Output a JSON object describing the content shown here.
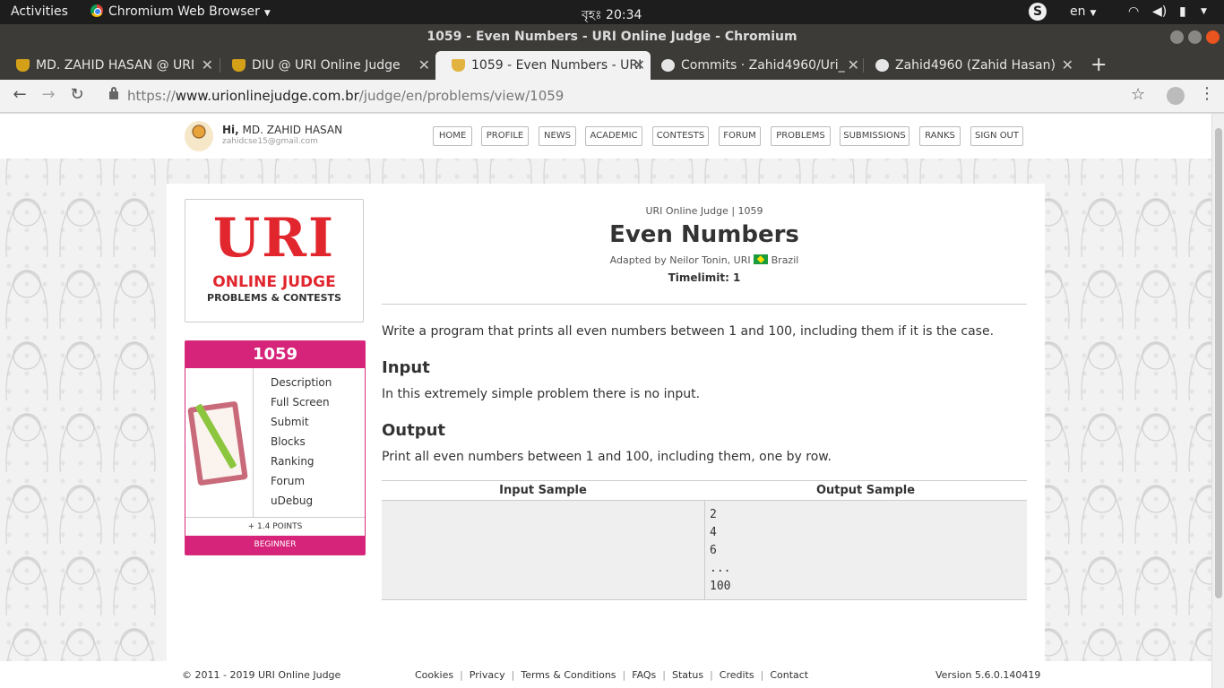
{
  "desktop": {
    "activities": "Activities",
    "app_menu": "Chromium Web Browser",
    "clock": "বৃহঃ 20:34",
    "language": "en"
  },
  "window": {
    "title": "1059 - Even Numbers - URI Online Judge - Chromium"
  },
  "tabs": [
    {
      "label": "MD. ZAHID HASAN @ URI",
      "icon": "trophy-icon"
    },
    {
      "label": "DIU @ URI Online Judge",
      "icon": "trophy-icon"
    },
    {
      "label": "1059 - Even Numbers - URI",
      "icon": "trophy-icon",
      "active": true
    },
    {
      "label": "Commits · Zahid4960/Uri_",
      "icon": "github-icon"
    },
    {
      "label": "Zahid4960 (Zahid Hasan)",
      "icon": "github-icon"
    }
  ],
  "address_bar": {
    "scheme": "https://",
    "host": "www.urionlinejudge.com.br",
    "path": "/judge/en/problems/view/1059"
  },
  "site": {
    "user": {
      "greeting": "Hi,",
      "name": "MD. ZAHID HASAN",
      "email": "zahidcse15@gmail.com"
    },
    "nav": [
      "HOME",
      "PROFILE",
      "NEWS",
      "ACADEMIC",
      "CONTESTS",
      "FORUM",
      "PROBLEMS",
      "SUBMISSIONS",
      "RANKS",
      "SIGN OUT"
    ]
  },
  "logo": {
    "main": "URI",
    "line1": "ONLINE JUDGE",
    "line2": "PROBLEMS & CONTESTS"
  },
  "problem_card": {
    "number": "1059",
    "links": [
      "Description",
      "Full Screen",
      "Submit",
      "Blocks",
      "Ranking",
      "Forum",
      "uDebug"
    ],
    "points": "+ 1.4 POINTS",
    "level": "BEGINNER"
  },
  "problem": {
    "breadcrumb": "URI Online Judge | 1059",
    "title": "Even Numbers",
    "adapted_prefix": "Adapted by Neilor Tonin, URI",
    "adapted_country": "Brazil",
    "timelimit": "Timelimit: 1",
    "description": "Write a program that prints all even numbers between 1 and 100, including them if it is the case.",
    "input_heading": "Input",
    "input_text": "In this extremely simple problem there is no input.",
    "output_heading": "Output",
    "output_text": "Print all even numbers between 1 and 100, including them, one by row.",
    "sample_input_header": "Input Sample",
    "sample_output_header": "Output Sample",
    "sample_input": "",
    "sample_output": "2\n4\n6\n...\n100"
  },
  "footer": {
    "copyright": "© 2011 - 2019 URI Online Judge",
    "links": [
      "Cookies",
      "Privacy",
      "Terms & Conditions",
      "FAQs",
      "Status",
      "Credits",
      "Contact"
    ],
    "version": "Version 5.6.0.140419"
  }
}
